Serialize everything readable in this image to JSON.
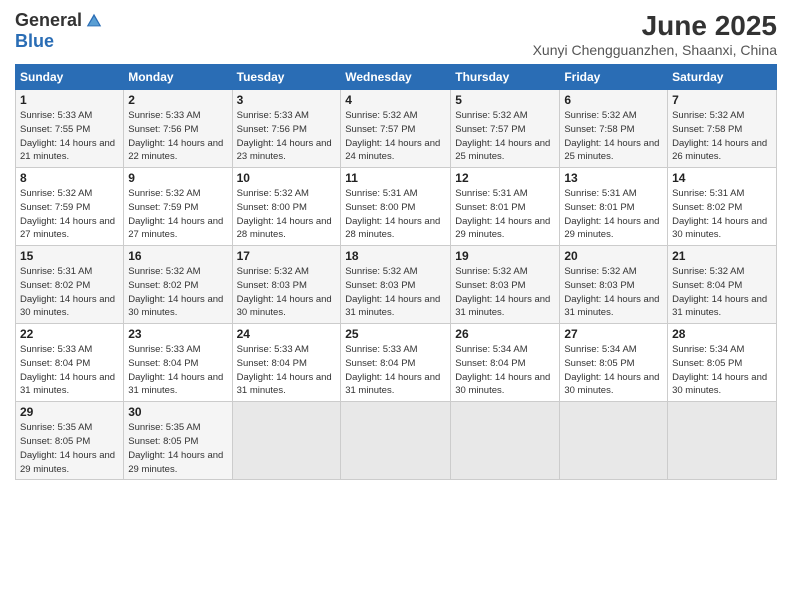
{
  "header": {
    "logo_general": "General",
    "logo_blue": "Blue",
    "title": "June 2025",
    "location": "Xunyi Chengguanzhen, Shaanxi, China"
  },
  "weekdays": [
    "Sunday",
    "Monday",
    "Tuesday",
    "Wednesday",
    "Thursday",
    "Friday",
    "Saturday"
  ],
  "weeks": [
    [
      {
        "day": "1",
        "sunrise": "Sunrise: 5:33 AM",
        "sunset": "Sunset: 7:55 PM",
        "daylight": "Daylight: 14 hours and 21 minutes."
      },
      {
        "day": "2",
        "sunrise": "Sunrise: 5:33 AM",
        "sunset": "Sunset: 7:56 PM",
        "daylight": "Daylight: 14 hours and 22 minutes."
      },
      {
        "day": "3",
        "sunrise": "Sunrise: 5:33 AM",
        "sunset": "Sunset: 7:56 PM",
        "daylight": "Daylight: 14 hours and 23 minutes."
      },
      {
        "day": "4",
        "sunrise": "Sunrise: 5:32 AM",
        "sunset": "Sunset: 7:57 PM",
        "daylight": "Daylight: 14 hours and 24 minutes."
      },
      {
        "day": "5",
        "sunrise": "Sunrise: 5:32 AM",
        "sunset": "Sunset: 7:57 PM",
        "daylight": "Daylight: 14 hours and 25 minutes."
      },
      {
        "day": "6",
        "sunrise": "Sunrise: 5:32 AM",
        "sunset": "Sunset: 7:58 PM",
        "daylight": "Daylight: 14 hours and 25 minutes."
      },
      {
        "day": "7",
        "sunrise": "Sunrise: 5:32 AM",
        "sunset": "Sunset: 7:58 PM",
        "daylight": "Daylight: 14 hours and 26 minutes."
      }
    ],
    [
      {
        "day": "8",
        "sunrise": "Sunrise: 5:32 AM",
        "sunset": "Sunset: 7:59 PM",
        "daylight": "Daylight: 14 hours and 27 minutes."
      },
      {
        "day": "9",
        "sunrise": "Sunrise: 5:32 AM",
        "sunset": "Sunset: 7:59 PM",
        "daylight": "Daylight: 14 hours and 27 minutes."
      },
      {
        "day": "10",
        "sunrise": "Sunrise: 5:32 AM",
        "sunset": "Sunset: 8:00 PM",
        "daylight": "Daylight: 14 hours and 28 minutes."
      },
      {
        "day": "11",
        "sunrise": "Sunrise: 5:31 AM",
        "sunset": "Sunset: 8:00 PM",
        "daylight": "Daylight: 14 hours and 28 minutes."
      },
      {
        "day": "12",
        "sunrise": "Sunrise: 5:31 AM",
        "sunset": "Sunset: 8:01 PM",
        "daylight": "Daylight: 14 hours and 29 minutes."
      },
      {
        "day": "13",
        "sunrise": "Sunrise: 5:31 AM",
        "sunset": "Sunset: 8:01 PM",
        "daylight": "Daylight: 14 hours and 29 minutes."
      },
      {
        "day": "14",
        "sunrise": "Sunrise: 5:31 AM",
        "sunset": "Sunset: 8:02 PM",
        "daylight": "Daylight: 14 hours and 30 minutes."
      }
    ],
    [
      {
        "day": "15",
        "sunrise": "Sunrise: 5:31 AM",
        "sunset": "Sunset: 8:02 PM",
        "daylight": "Daylight: 14 hours and 30 minutes."
      },
      {
        "day": "16",
        "sunrise": "Sunrise: 5:32 AM",
        "sunset": "Sunset: 8:02 PM",
        "daylight": "Daylight: 14 hours and 30 minutes."
      },
      {
        "day": "17",
        "sunrise": "Sunrise: 5:32 AM",
        "sunset": "Sunset: 8:03 PM",
        "daylight": "Daylight: 14 hours and 30 minutes."
      },
      {
        "day": "18",
        "sunrise": "Sunrise: 5:32 AM",
        "sunset": "Sunset: 8:03 PM",
        "daylight": "Daylight: 14 hours and 31 minutes."
      },
      {
        "day": "19",
        "sunrise": "Sunrise: 5:32 AM",
        "sunset": "Sunset: 8:03 PM",
        "daylight": "Daylight: 14 hours and 31 minutes."
      },
      {
        "day": "20",
        "sunrise": "Sunrise: 5:32 AM",
        "sunset": "Sunset: 8:03 PM",
        "daylight": "Daylight: 14 hours and 31 minutes."
      },
      {
        "day": "21",
        "sunrise": "Sunrise: 5:32 AM",
        "sunset": "Sunset: 8:04 PM",
        "daylight": "Daylight: 14 hours and 31 minutes."
      }
    ],
    [
      {
        "day": "22",
        "sunrise": "Sunrise: 5:33 AM",
        "sunset": "Sunset: 8:04 PM",
        "daylight": "Daylight: 14 hours and 31 minutes."
      },
      {
        "day": "23",
        "sunrise": "Sunrise: 5:33 AM",
        "sunset": "Sunset: 8:04 PM",
        "daylight": "Daylight: 14 hours and 31 minutes."
      },
      {
        "day": "24",
        "sunrise": "Sunrise: 5:33 AM",
        "sunset": "Sunset: 8:04 PM",
        "daylight": "Daylight: 14 hours and 31 minutes."
      },
      {
        "day": "25",
        "sunrise": "Sunrise: 5:33 AM",
        "sunset": "Sunset: 8:04 PM",
        "daylight": "Daylight: 14 hours and 31 minutes."
      },
      {
        "day": "26",
        "sunrise": "Sunrise: 5:34 AM",
        "sunset": "Sunset: 8:04 PM",
        "daylight": "Daylight: 14 hours and 30 minutes."
      },
      {
        "day": "27",
        "sunrise": "Sunrise: 5:34 AM",
        "sunset": "Sunset: 8:05 PM",
        "daylight": "Daylight: 14 hours and 30 minutes."
      },
      {
        "day": "28",
        "sunrise": "Sunrise: 5:34 AM",
        "sunset": "Sunset: 8:05 PM",
        "daylight": "Daylight: 14 hours and 30 minutes."
      }
    ],
    [
      {
        "day": "29",
        "sunrise": "Sunrise: 5:35 AM",
        "sunset": "Sunset: 8:05 PM",
        "daylight": "Daylight: 14 hours and 29 minutes."
      },
      {
        "day": "30",
        "sunrise": "Sunrise: 5:35 AM",
        "sunset": "Sunset: 8:05 PM",
        "daylight": "Daylight: 14 hours and 29 minutes."
      },
      null,
      null,
      null,
      null,
      null
    ]
  ]
}
